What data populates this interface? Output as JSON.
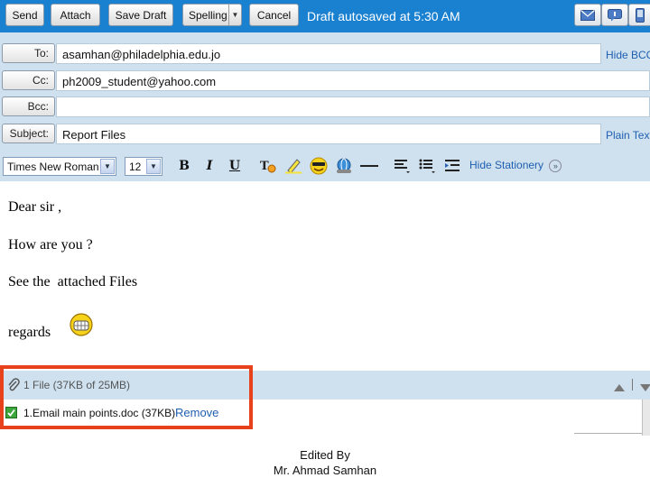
{
  "toolbar": {
    "send": "Send",
    "attach": "Attach",
    "save_draft": "Save Draft",
    "spelling": "Spelling",
    "cancel": "Cancel",
    "status": "Draft autosaved at 5:30 AM",
    "icons": [
      "mail-icon",
      "chat-icon",
      "mobile-icon"
    ]
  },
  "fields": {
    "to_label": "To:",
    "to_value": "asamhan@philadelphia.edu.jo",
    "hide_bcc": "Hide BCC",
    "cc_label": "Cc:",
    "cc_value": "ph2009_student@yahoo.com",
    "bcc_label": "Bcc:",
    "bcc_value": "",
    "subject_label": "Subject:",
    "subject_value": "Report Files",
    "plain_text": "Plain Text"
  },
  "format": {
    "font": "Times New Roman",
    "size": "12",
    "hide_stationery": "Hide Stationery"
  },
  "body": {
    "line1": "Dear sir ,",
    "line2": "How are you ?",
    "line3": "See the  attached Files",
    "line4": "regards"
  },
  "attachments": {
    "count": "1 File  (37KB of 25MB)",
    "file": "1.Email main points.doc (37KB)",
    "remove": "Remove"
  },
  "footer": {
    "line1": "Edited By",
    "line2": "Mr. Ahmad Samhan"
  },
  "colors": {
    "toolbar_bg": "#1a80d0",
    "header_bg": "#cfe1ef",
    "link": "#1f5fb0",
    "highlight_box": "#e8421c"
  }
}
